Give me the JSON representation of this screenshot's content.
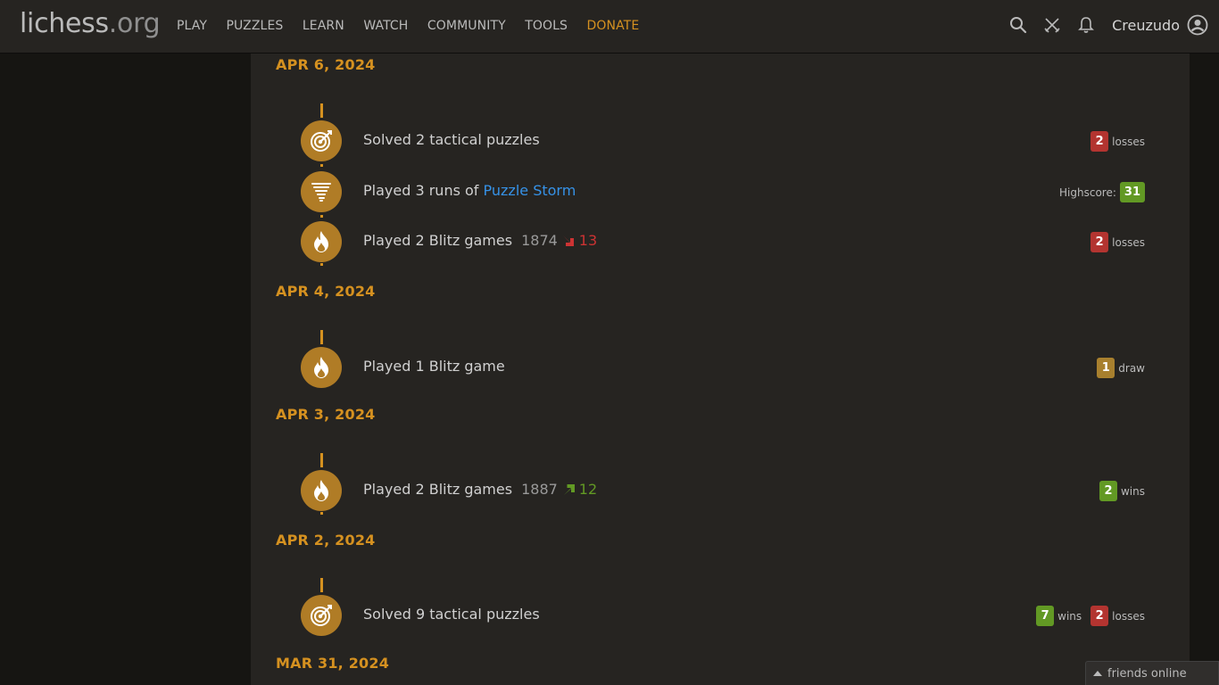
{
  "header": {
    "logo_main": "lichess",
    "logo_tld": ".org",
    "nav": [
      "PLAY",
      "PUZZLES",
      "LEARN",
      "WATCH",
      "COMMUNITY",
      "TOOLS",
      "DONATE"
    ],
    "username": "Creuzudo",
    "icons": [
      "search-icon",
      "challenge-swords-icon",
      "bell-icon",
      "user-avatar-icon"
    ]
  },
  "days": [
    {
      "date": "APR 6, 2024",
      "entries": [
        {
          "icon": "puzzle-target-icon",
          "text": "Solved 2 tactical puzzles",
          "score": {
            "losses": "2",
            "losses_label": "losses"
          }
        },
        {
          "icon": "storm-tornado-icon",
          "text_prefix": "Played 3 runs of ",
          "link": "Puzzle Storm",
          "score": {
            "highscore_label": "Highscore:",
            "highscore": "31"
          }
        },
        {
          "icon": "blitz-fire-icon",
          "text": "Played 2 Blitz games",
          "rating": "1874",
          "rating_diff": "13",
          "rating_dir": "down",
          "score": {
            "losses": "2",
            "losses_label": "losses"
          }
        }
      ]
    },
    {
      "date": "APR 4, 2024",
      "entries": [
        {
          "icon": "blitz-fire-icon",
          "text": "Played 1 Blitz game",
          "score": {
            "draws": "1",
            "draws_label": "draw"
          }
        }
      ]
    },
    {
      "date": "APR 3, 2024",
      "entries": [
        {
          "icon": "blitz-fire-icon",
          "text": "Played 2 Blitz games",
          "rating": "1887",
          "rating_diff": "12",
          "rating_dir": "up",
          "score": {
            "wins": "2",
            "wins_label": "wins"
          }
        }
      ]
    },
    {
      "date": "APR 2, 2024",
      "entries": [
        {
          "icon": "puzzle-target-icon",
          "text": "Solved 9 tactical puzzles",
          "score": {
            "wins": "7",
            "wins_label": "wins",
            "losses": "2",
            "losses_label": "losses"
          }
        }
      ]
    },
    {
      "date": "MAR 31, 2024",
      "entries": []
    }
  ],
  "friends": {
    "label": "friends online"
  },
  "colors": {
    "accent": "#d59120",
    "win": "#629924",
    "loss": "#b33430",
    "link": "#3692e7"
  }
}
